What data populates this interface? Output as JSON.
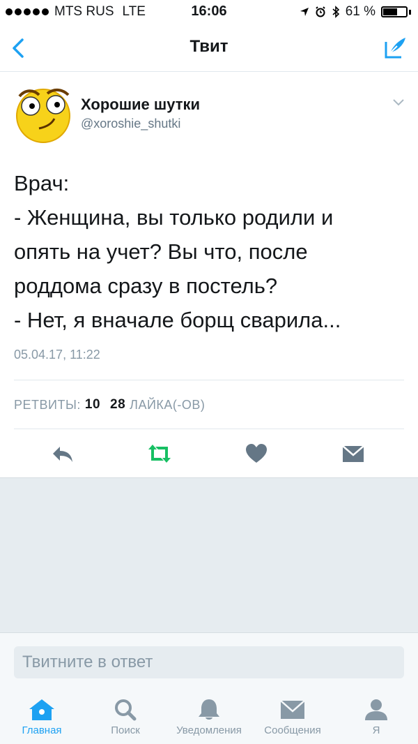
{
  "status_bar": {
    "carrier": "MTS RUS",
    "network": "LTE",
    "time": "16:06",
    "battery_text": "61 %",
    "battery_level": 0.61
  },
  "nav": {
    "title": "Твит",
    "back_icon": "chevron-left-icon",
    "compose_icon": "compose-tweet-icon",
    "accent_color": "#1da1f2"
  },
  "tweet": {
    "user_name": "Хорошие шутки",
    "handle": "@xoroshie_shutki",
    "lines": [
      "Врач:",
      "- Женщина, вы только родили и",
      "опять на учет? Вы что, после",
      "роддома сразу в постель?",
      "- Нет, я вначале борщ сварила..."
    ],
    "timestamp": "05.04.17, 11:22",
    "retweets_label": "РЕТВИТЫ:",
    "retweets_count": "10",
    "likes_count": "28",
    "likes_label": "ЛАЙКА(-ОВ)"
  },
  "actions": [
    "reply-icon",
    "retweet-icon",
    "heart-icon",
    "direct-message-icon"
  ],
  "reply": {
    "placeholder": "Твитните в ответ"
  },
  "tabbar": {
    "tabs": [
      {
        "label": "Главная",
        "icon": "home-icon",
        "active": true
      },
      {
        "label": "Поиск",
        "icon": "search-icon",
        "active": false
      },
      {
        "label": "Уведомления",
        "icon": "bell-icon",
        "active": false
      },
      {
        "label": "Сообщения",
        "icon": "envelope-icon",
        "active": false
      },
      {
        "label": "Я",
        "icon": "profile-icon",
        "active": false
      }
    ]
  }
}
